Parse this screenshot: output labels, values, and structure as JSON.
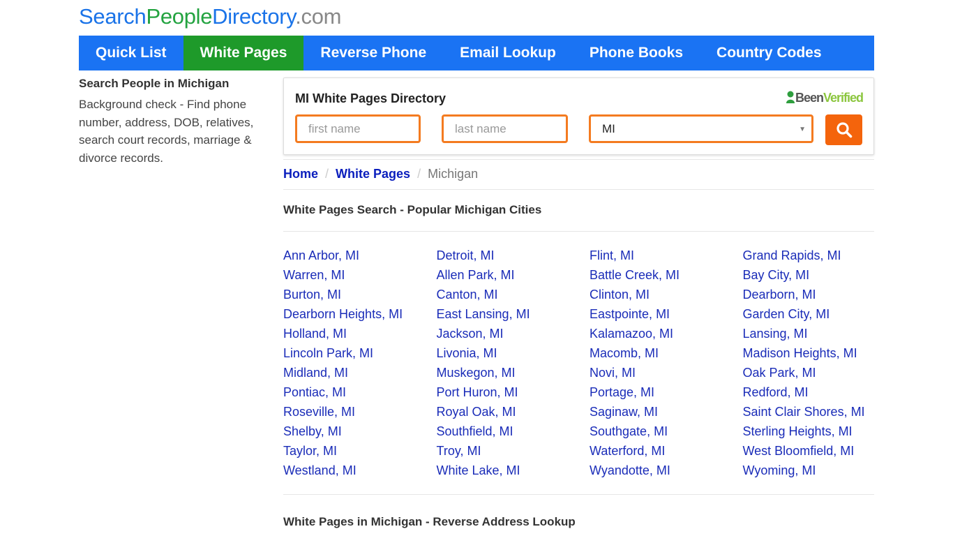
{
  "logo": {
    "part1": "Search",
    "part2": "People",
    "part3": "Directory",
    "part4": ".com"
  },
  "nav": [
    "Quick List",
    "White Pages",
    "Reverse Phone",
    "Email Lookup",
    "Phone Books",
    "Country Codes"
  ],
  "sidebar": {
    "heading": "Search People in Michigan",
    "text": "Background check - Find phone number, address, DOB, relatives, search court records, marriage & divorce records."
  },
  "search": {
    "title": "MI White Pages Directory",
    "brand": {
      "part1": "Been",
      "part2": "Verified"
    },
    "first_placeholder": "first name",
    "last_placeholder": "last name",
    "state_value": "MI"
  },
  "breadcrumb": {
    "home": "Home",
    "white_pages": "White Pages",
    "current": "Michigan"
  },
  "section1_title": "White Pages Search - Popular Michigan Cities",
  "cities": [
    "Ann Arbor,  MI",
    "Detroit,  MI",
    "Flint,  MI",
    "Grand Rapids,  MI",
    "Warren,  MI",
    "Allen Park,  MI",
    "Battle Creek,  MI",
    "Bay City,  MI",
    "Burton,  MI",
    "Canton,  MI",
    "Clinton,  MI",
    "Dearborn,  MI",
    "Dearborn Heights,  MI",
    "East Lansing,  MI",
    "Eastpointe,  MI",
    "Garden City,  MI",
    "Holland,  MI",
    "Jackson,  MI",
    "Kalamazoo,  MI",
    "Lansing,  MI",
    "Lincoln Park,  MI",
    "Livonia,  MI",
    "Macomb,  MI",
    "Madison Heights,  MI",
    "Midland,  MI",
    "Muskegon,  MI",
    "Novi,  MI",
    "Oak Park,  MI",
    "Pontiac,  MI",
    "Port Huron,  MI",
    "Portage,  MI",
    "Redford,  MI",
    "Roseville,  MI",
    "Royal Oak,  MI",
    "Saginaw,  MI",
    "Saint Clair Shores,  MI",
    "Shelby,  MI",
    "Southfield,  MI",
    "Southgate,  MI",
    "Sterling Heights,  MI",
    "Taylor,  MI",
    "Troy,  MI",
    "Waterford,  MI",
    "West Bloomfield,  MI",
    "Westland,  MI",
    "White Lake,  MI",
    "Wyandotte,  MI",
    "Wyoming,  MI"
  ],
  "section2_title": "White Pages in Michigan - Reverse Address Lookup",
  "colors": {
    "nav_bg": "#1a73f3",
    "nav_active": "#1e9a2a",
    "accent_orange": "#f47b20",
    "link": "#1a2cb8"
  }
}
